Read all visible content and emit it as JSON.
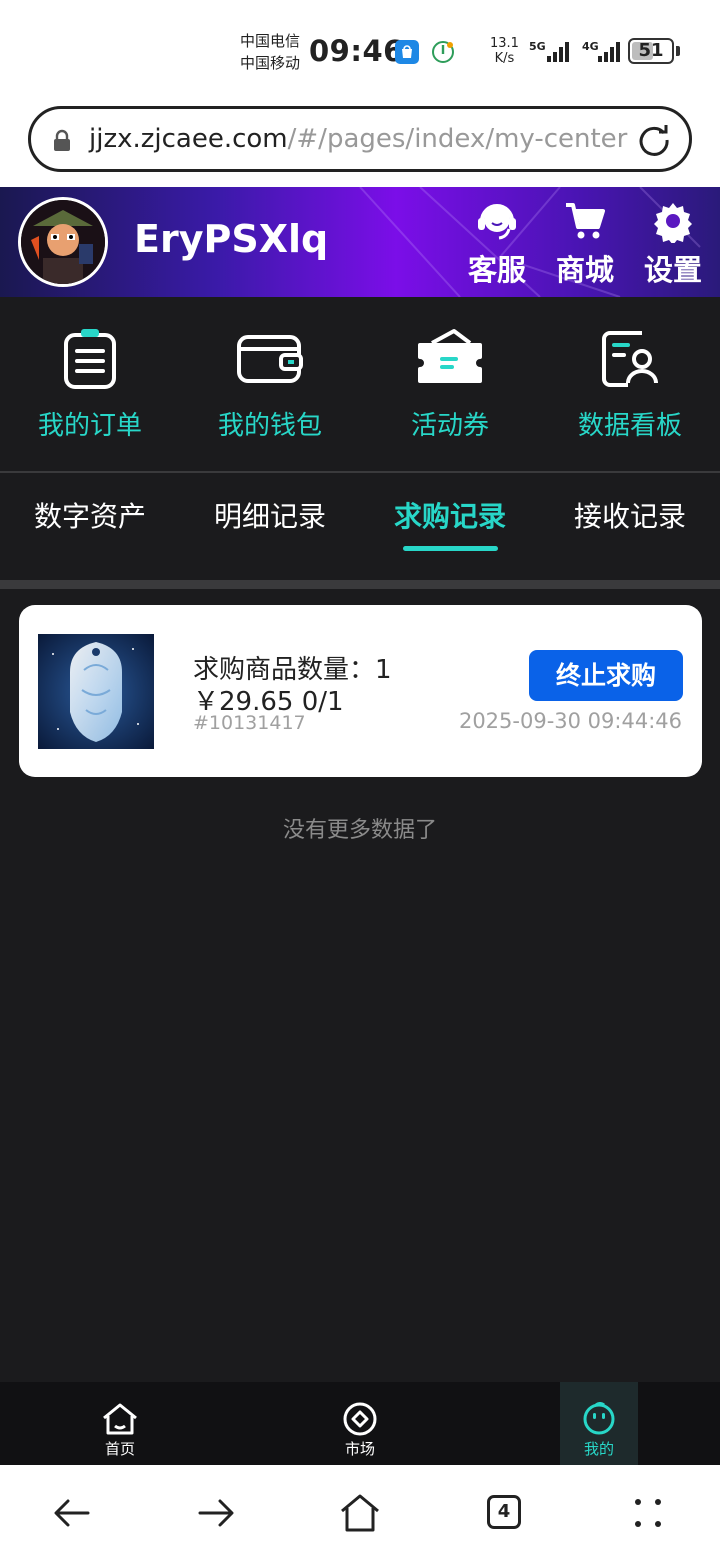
{
  "status_bar": {
    "carrier_1": "中国电信",
    "carrier_2": "中国移动",
    "time": "09:46",
    "speed_value": "13.1",
    "speed_unit": "K/s",
    "net_1": "5G",
    "net_2": "4G",
    "battery": "51"
  },
  "browser": {
    "url_host": "jjzx.zjcaee.com",
    "url_path": "/#/pages/index/my-center",
    "tab_count": "4"
  },
  "header": {
    "username": "EryPSXlq",
    "buttons": [
      {
        "label": "客服",
        "icon": "headset-icon"
      },
      {
        "label": "商城",
        "icon": "cart-icon"
      },
      {
        "label": "设置",
        "icon": "gear-icon"
      }
    ],
    "colors": {
      "gradient_start": "#1a1850",
      "gradient_mid": "#7b0ee8"
    }
  },
  "quick_actions": [
    {
      "label": "我的订单",
      "icon": "clipboard-icon"
    },
    {
      "label": "我的钱包",
      "icon": "wallet-icon"
    },
    {
      "label": "活动券",
      "icon": "coupon-icon"
    },
    {
      "label": "数据看板",
      "icon": "dashboard-icon"
    }
  ],
  "tabs": [
    {
      "label": "数字资产",
      "active": false
    },
    {
      "label": "明细记录",
      "active": false
    },
    {
      "label": "求购记录",
      "active": true
    },
    {
      "label": "接收记录",
      "active": false
    }
  ],
  "purchase_card": {
    "quantity_text": "求购商品数量：1",
    "price_text": "￥29.65 0/1",
    "id_text": "#10131417",
    "button_label": "终止求购",
    "timestamp": "2025-09-30 09:44:46"
  },
  "no_more_text": "没有更多数据了",
  "bottom_nav": [
    {
      "label": "首页",
      "icon": "home-icon",
      "active": false
    },
    {
      "label": "市场",
      "icon": "market-icon",
      "active": false
    },
    {
      "label": "我的",
      "icon": "profile-icon",
      "active": true
    }
  ],
  "colors": {
    "accent": "#28d7c8",
    "button_blue": "#0a62e8",
    "background": "#1b1b1d"
  }
}
